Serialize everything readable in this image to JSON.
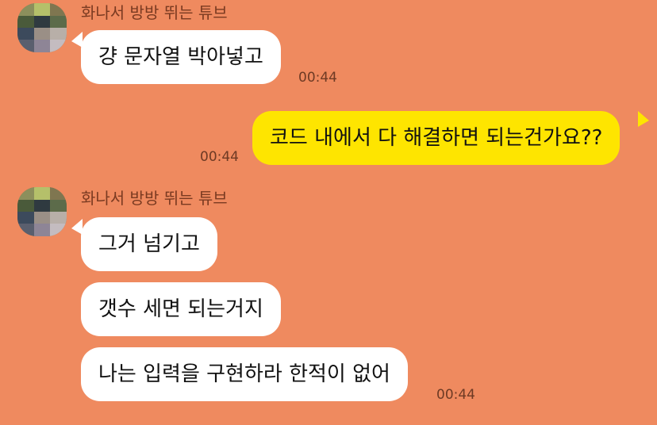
{
  "chat": {
    "background_color": "#EF8A5F",
    "incoming_bubble_color": "#FFFFFF",
    "outgoing_bubble_color": "#FEE500",
    "messages": [
      {
        "sender": "화나서 방방 뛰는 튜브",
        "direction": "incoming",
        "text": "걍 문자열 박아넣고",
        "time": "00:44"
      },
      {
        "direction": "outgoing",
        "text": "코드 내에서 다 해결하면 되는건가요??",
        "time": "00:44"
      },
      {
        "sender": "화나서 방방 뛰는 튜브",
        "direction": "incoming",
        "texts": [
          "그거 넘기고",
          "갯수 세면 되는거지",
          "나는 입력을 구현하라 한적이 없어"
        ],
        "time": "00:44"
      }
    ]
  }
}
